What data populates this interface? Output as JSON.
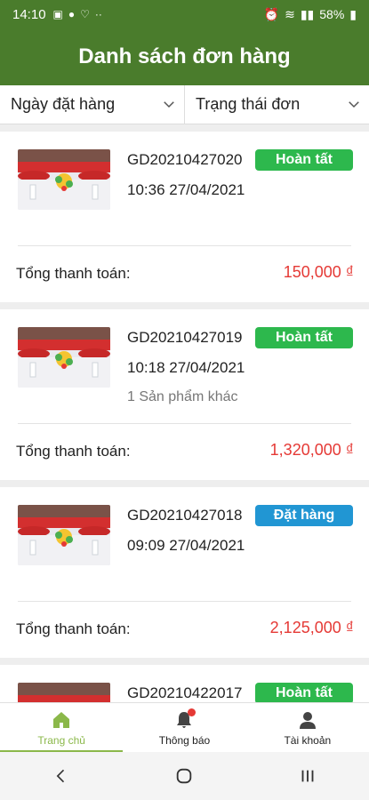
{
  "status_bar": {
    "time": "14:10",
    "battery": "58%"
  },
  "header": {
    "title": "Danh sách đơn hàng"
  },
  "filters": [
    {
      "label": "Ngày đặt hàng",
      "icon": "chevron-down-icon"
    },
    {
      "label": "Trạng thái đơn",
      "icon": "chevron-down-icon"
    }
  ],
  "total_label": "Tổng thanh toán:",
  "orders": [
    {
      "code": "GD20210427020",
      "date": "10:36 27/04/2021",
      "extra": "",
      "status": "Hoàn tất",
      "status_color": "#2db84d",
      "total": "150,000 ₫"
    },
    {
      "code": "GD20210427019",
      "date": "10:18 27/04/2021",
      "extra": "1 Sản phẩm khác",
      "status": "Hoàn tất",
      "status_color": "#2db84d",
      "total": "1,320,000 ₫"
    },
    {
      "code": "GD20210427018",
      "date": "09:09 27/04/2021",
      "extra": "",
      "status": "Đặt hàng",
      "status_color": "#2196d3",
      "total": "2,125,000 ₫"
    },
    {
      "code": "GD20210422017",
      "date": "",
      "extra": "",
      "status": "Hoàn tất",
      "status_color": "#2db84d",
      "total": ""
    }
  ],
  "bottom_nav": [
    {
      "label": "Trang chủ",
      "icon": "home-icon"
    },
    {
      "label": "Thông báo",
      "icon": "bell-icon"
    },
    {
      "label": "Tài khoản",
      "icon": "user-icon"
    }
  ],
  "colors": {
    "primary": "#4a7c2c",
    "accent": "#8bb84a",
    "price": "#e53935"
  }
}
